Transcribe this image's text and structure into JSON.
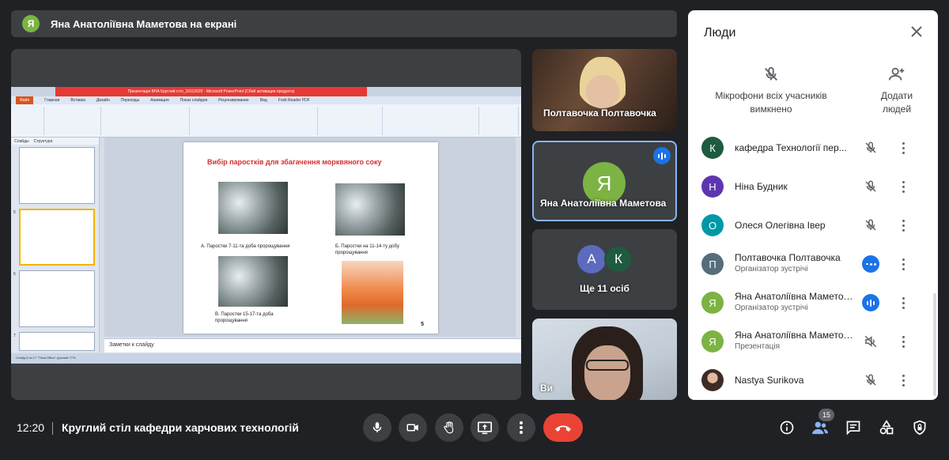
{
  "banner": {
    "avatar_letter": "Я",
    "text": "Яна Анатоліївна Маметова на екрані"
  },
  "presentation": {
    "window_title": "Презентація ВНА Круглий стіл_10112020 - Microsoft PowerPoint (Сбой активации продукта)",
    "tabs": [
      "Файл",
      "Главная",
      "Вставка",
      "Дизайн",
      "Переходы",
      "Анимация",
      "Показ слайдов",
      "Рецензирование",
      "Вид",
      "Foxit Reader PDF"
    ],
    "panel_tabs": [
      "Слайды",
      "Структура"
    ],
    "thumb_numbers": [
      "5",
      "6",
      "7"
    ],
    "slide": {
      "title": "Вибір паростків для збагачення морквяного соку",
      "cap_a": "А. Паростки 7-11-та доба пророщування",
      "cap_b": "Б. Паростки на 11-14-ту добу пророщування",
      "cap_c": "В. Паростки 15-17-та доба пророщування",
      "number": "5"
    },
    "notes": "Заметки к слайду",
    "status": "Слайд 5 из 17   \"Тема Office\"   русский                                                                                            77%"
  },
  "tiles": [
    {
      "name": "Полтавочка Полтавочка"
    },
    {
      "name": "Яна Анатоліївна Маметова",
      "avatar_letter": "Я"
    },
    {
      "name": "Ще 11 осіб",
      "mini": [
        "А",
        "К"
      ]
    },
    {
      "name": "Ви"
    }
  ],
  "people": {
    "title": "Люди",
    "mute_all": "Мікрофони всіх учасників вимкнено",
    "add_people": "Додати людей",
    "list": [
      {
        "letter": "К",
        "name": "кафедра Технології пер...",
        "role": "",
        "color": "#1e5b3f",
        "icon": "mic-off"
      },
      {
        "letter": "Н",
        "name": "Ніна Будник",
        "role": "",
        "color": "#5e35b1",
        "icon": "mic-off"
      },
      {
        "letter": "О",
        "name": "Олеся Олегівна Івер",
        "role": "",
        "color": "#0097a7",
        "icon": "mic-off"
      },
      {
        "letter": "П",
        "name": "Полтавочка Полтавочка",
        "role": "Організатор зустрічі",
        "color": "#546e7a",
        "icon": "more"
      },
      {
        "letter": "Я",
        "name": "Яна Анатоліївна Маметова",
        "role": "Організатор зустрічі",
        "color": "#7cb342",
        "icon": "speaking"
      },
      {
        "letter": "Я",
        "name": "Яна Анатоліївна Маметова",
        "role": "Презентація",
        "color": "#7cb342",
        "icon": "present-off"
      },
      {
        "letter": "",
        "name": "Nastya Surikova",
        "role": "",
        "color": "#6d4c41",
        "icon": "mic-off"
      }
    ]
  },
  "bottom": {
    "time": "12:20",
    "meeting": "Круглий стіл кафедри харчових технологій",
    "participants_count": "15"
  }
}
